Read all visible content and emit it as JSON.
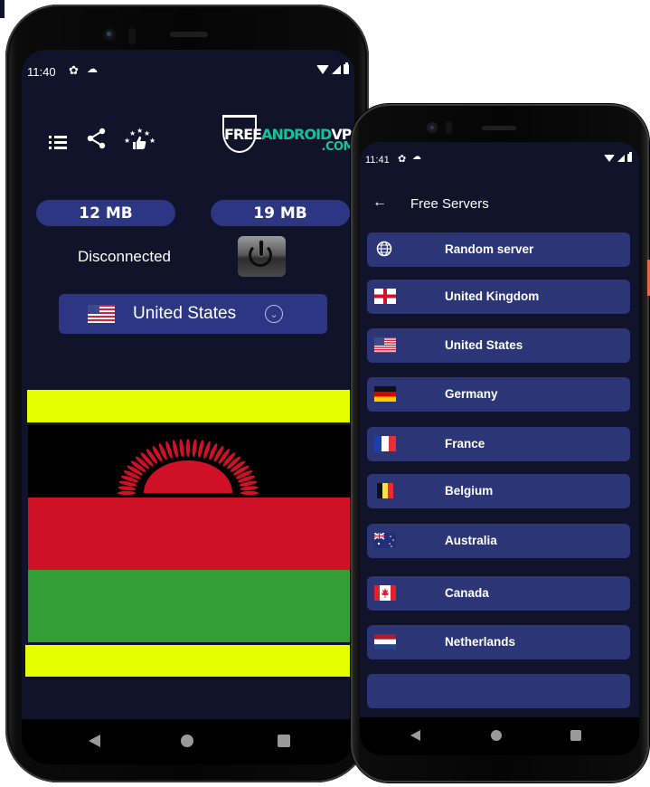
{
  "main_phone": {
    "status_bar": {
      "time": "11:40",
      "left_icons": [
        "gear-icon",
        "cloud-icon"
      ],
      "right_icons": [
        "wifi-icon",
        "signal-icon",
        "battery-icon"
      ]
    },
    "toolbar": {
      "icons": [
        "menu-list-icon",
        "share-icon",
        "rate-thumbs-up-stars-icon"
      ]
    },
    "logo": {
      "part1": "FREE",
      "part2": "ANDROID",
      "part3": "VPN",
      "suffix": ".COM"
    },
    "traffic": {
      "download": "12 MB",
      "upload": "19 MB"
    },
    "connection_status": "Disconnected",
    "power_button_icon": "power-icon",
    "selected_country": {
      "name": "United States",
      "flag": "us-flag",
      "dropdown_icon": "chevron-down-circle-icon"
    },
    "displayed_flag": "Malawi",
    "colors": {
      "background": "#10132a",
      "accent": "#2c3683",
      "flag_yellow": "#e6ff00",
      "flag_black": "#000000",
      "flag_red": "#ce1126",
      "flag_green": "#339e35"
    },
    "nav": [
      "back",
      "home",
      "recents"
    ]
  },
  "server_phone": {
    "status_bar": {
      "time": "11:41",
      "left_icons": [
        "gear-icon",
        "cloud-icon"
      ],
      "right_icons": [
        "wifi-icon",
        "signal-icon",
        "battery-icon"
      ]
    },
    "header": {
      "back_icon": "arrow-left-icon",
      "title": "Free Servers"
    },
    "servers": [
      {
        "name": "Random server",
        "icon": "globe-icon"
      },
      {
        "name": "United Kingdom",
        "icon": "england-flag"
      },
      {
        "name": "United States",
        "icon": "us-flag"
      },
      {
        "name": "Germany",
        "icon": "germany-flag"
      },
      {
        "name": "France",
        "icon": "france-flag"
      },
      {
        "name": "Belgium",
        "icon": "belgium-flag"
      },
      {
        "name": "Australia",
        "icon": "australia-flag"
      },
      {
        "name": "Canada",
        "icon": "canada-flag"
      },
      {
        "name": "Netherlands",
        "icon": "netherlands-flag"
      }
    ],
    "colors": {
      "item_background": "#2c3677"
    },
    "nav": [
      "back",
      "home",
      "recents"
    ]
  }
}
